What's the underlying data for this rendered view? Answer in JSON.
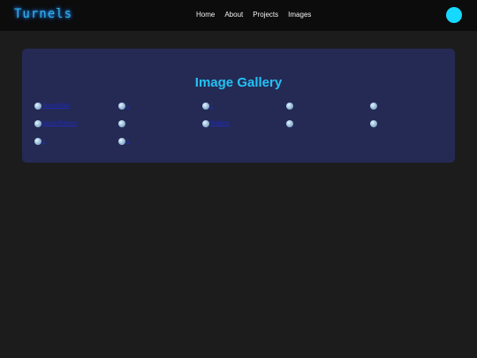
{
  "navbar": {
    "logo": "Turnels",
    "links": [
      "Home",
      "About",
      "Projects",
      "Images"
    ],
    "colors": {
      "background": "#0c0c0c",
      "avatar": "#16d9ff",
      "logo": "#2bb6e6"
    }
  },
  "gallery": {
    "title": "Image Gallery",
    "colors": {
      "panel": "#252a54",
      "title": "#22c2f6",
      "link": "#1f2bb8"
    },
    "items": [
      {
        "alt": "Screenshot"
      },
      {
        "alt": "1"
      },
      {
        "alt": "1"
      },
      {
        "alt": ""
      },
      {
        "alt": ""
      },
      {
        "alt": "Movie Preview"
      },
      {
        "alt": ""
      },
      {
        "alt": "Website"
      },
      {
        "alt": ""
      },
      {
        "alt": ""
      },
      {
        "alt": "1"
      },
      {
        "alt": "1"
      }
    ]
  }
}
